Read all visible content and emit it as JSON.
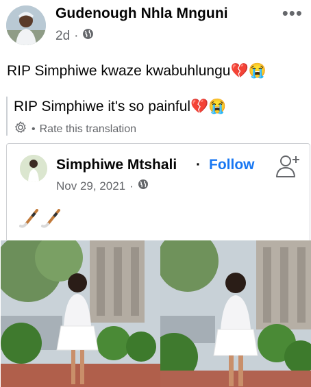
{
  "post": {
    "author": "Gudenough Nhla Mnguni",
    "time": "2d",
    "text": "RIP Simphiwe kwaze kwabuhlungu💔😭",
    "translation": "RIP Simphiwe it's so painful💔😭",
    "rate_label": "Rate this translation"
  },
  "shared": {
    "author": "Simphiwe Mtshali",
    "follow_label": "Follow",
    "date": "Nov 29, 2021",
    "emojis": "🏒🏒"
  },
  "colors": {
    "link_blue": "#1877f2",
    "secondary_text": "#65676b",
    "border": "#ced0d4"
  },
  "icons": [
    "globe-icon",
    "more-icon",
    "gear-icon",
    "add-friend-icon",
    "hockey-stick-icon"
  ]
}
